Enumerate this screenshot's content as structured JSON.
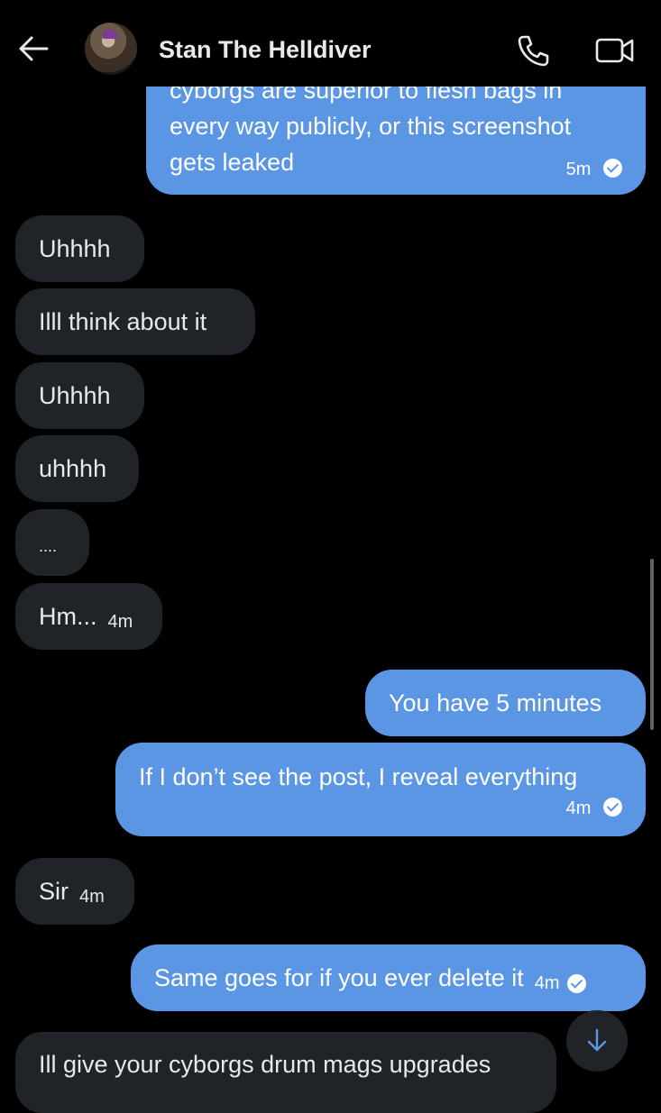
{
  "header": {
    "contact_name": "Stan The Helldiver",
    "icons": {
      "back": "arrow-left-icon",
      "call": "phone-icon",
      "video": "video-camera-icon"
    }
  },
  "messages": [
    {
      "direction": "out",
      "lines": [
        "cyborgs are superior to flesh bags in",
        "every way publicly, or this screenshot",
        "gets leaked"
      ],
      "time": "5m",
      "read": true
    },
    {
      "direction": "in",
      "text": "Uhhhh"
    },
    {
      "direction": "in",
      "text": "Illl think about it"
    },
    {
      "direction": "in",
      "text": "Uhhhh"
    },
    {
      "direction": "in",
      "text": "uhhhh"
    },
    {
      "direction": "in",
      "text": "...."
    },
    {
      "direction": "in",
      "text": "Hm...",
      "time": "4m"
    },
    {
      "direction": "out",
      "text": "You have 5 minutes"
    },
    {
      "direction": "out",
      "text": "If I don’t see the post, I reveal everything",
      "time": "4m",
      "read": true
    },
    {
      "direction": "in",
      "text": "Sir",
      "time": "4m"
    },
    {
      "direction": "out",
      "text": "Same goes for if you ever delete it",
      "time": "4m",
      "read": true
    },
    {
      "direction": "in",
      "text": "Ill give your cyborgs drum mags upgrades"
    }
  ],
  "colors": {
    "background": "#000000",
    "incoming_bubble": "#202327",
    "outgoing_bubble": "#5b96e5"
  },
  "scroll_button_icon": "arrow-down-icon"
}
